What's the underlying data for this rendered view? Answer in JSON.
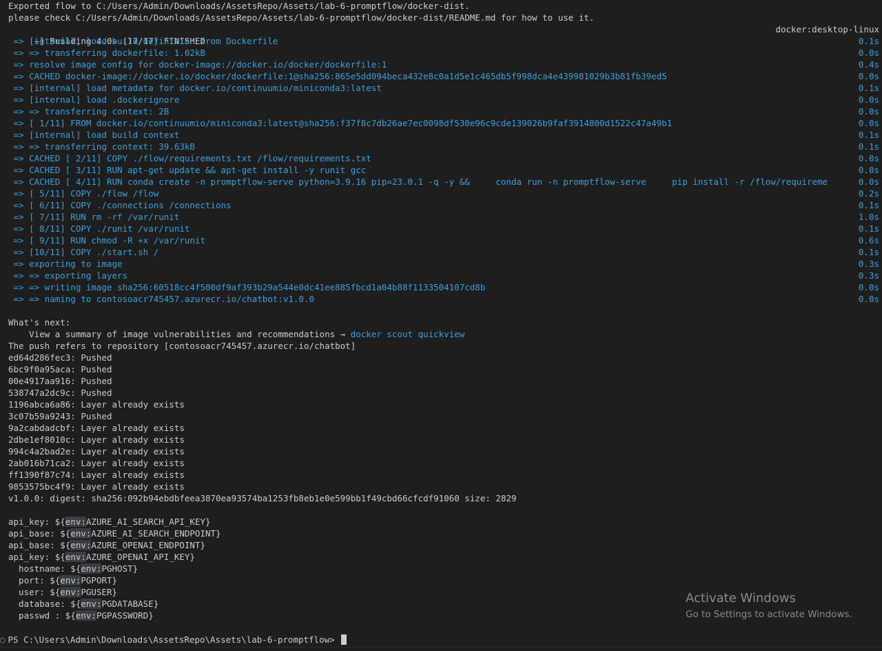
{
  "export_lines": [
    "Exported flow to C:/Users/Admin/Downloads/AssetsRepo/Assets/lab-6-promptflow/docker-dist.",
    "please check C:/Users/Admin/Downloads/AssetsRepo/Assets/lab-6-promptflow/docker-dist/README.md for how to use it."
  ],
  "build_header": {
    "text": "[+] Building 4.0s (17/17) FINISHED",
    "context": "docker:desktop-linux"
  },
  "build_steps": [
    {
      "text": " => [internal] load build definition from Dockerfile",
      "time": "0.1s"
    },
    {
      "text": " => => transferring dockerfile: 1.02kB",
      "time": "0.0s"
    },
    {
      "text": " => resolve image config for docker-image://docker.io/docker/dockerfile:1",
      "time": "0.4s"
    },
    {
      "text": " => CACHED docker-image://docker.io/docker/dockerfile:1@sha256:865e5dd094beca432e8c0a1d5e1c465db5f998dca4e439981029b3b81fb39ed5",
      "time": "0.0s"
    },
    {
      "text": " => [internal] load metadata for docker.io/continuumio/miniconda3:latest",
      "time": "0.1s"
    },
    {
      "text": " => [internal] load .dockerignore",
      "time": "0.0s"
    },
    {
      "text": " => => transferring context: 2B",
      "time": "0.0s"
    },
    {
      "text": " => [ 1/11] FROM docker.io/continuumio/miniconda3:latest@sha256:f37f8c7db26ae7ec0098df530e96c9cde139026b9faf3914800d1522c47a49b1",
      "time": "0.0s"
    },
    {
      "text": " => [internal] load build context",
      "time": "0.1s"
    },
    {
      "text": " => => transferring context: 39.63kB",
      "time": "0.1s"
    },
    {
      "text": " => CACHED [ 2/11] COPY ./flow/requirements.txt /flow/requirements.txt",
      "time": "0.0s"
    },
    {
      "text": " => CACHED [ 3/11] RUN apt-get update && apt-get install -y runit gcc",
      "time": "0.0s"
    },
    {
      "text": " => CACHED [ 4/11] RUN conda create -n promptflow-serve python=3.9.16 pip=23.0.1 -q -y &&     conda run -n promptflow-serve     pip install -r /flow/requireme",
      "time": "0.0s"
    },
    {
      "text": " => [ 5/11] COPY ./flow /flow",
      "time": "0.2s"
    },
    {
      "text": " => [ 6/11] COPY ./connections /connections",
      "time": "0.1s"
    },
    {
      "text": " => [ 7/11] RUN rm -rf /var/runit",
      "time": "1.0s"
    },
    {
      "text": " => [ 8/11] COPY ./runit /var/runit",
      "time": "0.1s"
    },
    {
      "text": " => [ 9/11] RUN chmod -R +x /var/runit",
      "time": "0.6s"
    },
    {
      "text": " => [10/11] COPY ./start.sh /",
      "time": "0.1s"
    },
    {
      "text": " => exporting to image",
      "time": "0.3s"
    },
    {
      "text": " => => exporting layers",
      "time": "0.3s"
    },
    {
      "text": " => => writing image sha256:60518cc4f500df9af393b29a544e0dc41ee885fbcd1a04b88f1133504107cd8b",
      "time": "0.0s"
    },
    {
      "text": " => => naming to contosoacr745457.azurecr.io/chatbot:v1.0.0",
      "time": "0.0s"
    }
  ],
  "whats_next": {
    "heading": "What's next:",
    "text": "    View a summary of image vulnerabilities and recommendations → ",
    "command": "docker scout quickview"
  },
  "push_header": "The push refers to repository [contosoacr745457.azurecr.io/chatbot]",
  "push_layers": [
    "ed64d286fec3: Pushed",
    "6bc9f0a95aca: Pushed",
    "00e4917aa916: Pushed",
    "538747a2dc9c: Pushed",
    "1196abca6a86: Layer already exists",
    "3c07b59a9243: Pushed",
    "9a2cabdadcbf: Layer already exists",
    "2dbe1ef8010c: Layer already exists",
    "994c4a2bad2e: Layer already exists",
    "2ab016b71ca2: Layer already exists",
    "ff1390f87c74: Layer already exists",
    "9853575bc4f9: Layer already exists"
  ],
  "digest": "v1.0.0: digest: sha256:092b94ebdbfeea3870ea93574ba1253fb8eb1e0e599bb1f49cbd66cfcdf91060 size: 2829",
  "env_refs": [
    {
      "prefix": "api_key: ${",
      "env": "env:",
      "var": "AZURE_AI_SEARCH_API_KEY}"
    },
    {
      "prefix": "api_base: ${",
      "env": "env:",
      "var": "AZURE_AI_SEARCH_ENDPOINT}"
    },
    {
      "prefix": "api_base: ${",
      "env": "env:",
      "var": "AZURE_OPENAI_ENDPOINT}"
    },
    {
      "prefix": "api_key: ${",
      "env": "env:",
      "var": "AZURE_OPENAI_API_KEY}"
    },
    {
      "prefix": "  hostname: ${",
      "env": "env:",
      "var": "PGHOST}"
    },
    {
      "prefix": "  port: ${",
      "env": "env:",
      "var": "PGPORT}"
    },
    {
      "prefix": "  user: ${",
      "env": "env:",
      "var": "PGUSER}"
    },
    {
      "prefix": "  database: ${",
      "env": "env:",
      "var": "PGDATABASE}"
    },
    {
      "prefix": "  passwd : ${",
      "env": "env:",
      "var": "PGPASSWORD}"
    }
  ],
  "watermark": {
    "title": "Activate Windows",
    "subtitle": "Go to Settings to activate Windows."
  },
  "prompt": {
    "marker": "○",
    "text": "PS C:\\Users\\Admin\\Downloads\\AssetsRepo\\Assets\\lab-6-promptflow> "
  },
  "colors": {
    "background": "#1e1e1e",
    "foreground": "#cccccc",
    "step_blue": "#3b9fd8",
    "env_highlight": "#3a3d41"
  }
}
